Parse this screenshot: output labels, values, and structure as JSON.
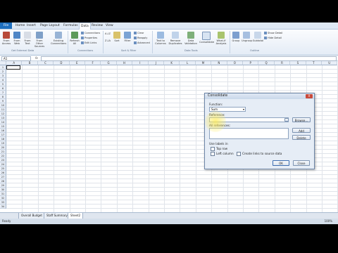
{
  "tabs": [
    "File",
    "Home",
    "Insert",
    "Page Layout",
    "Formulas",
    "Data",
    "Review",
    "View"
  ],
  "ribbon": {
    "buttons": [
      "From Access",
      "From Web",
      "From Text",
      "From Other Sources",
      "Existing Connections",
      "Refresh All",
      "Sort",
      "Filter",
      "Text to Columns",
      "Remove Duplicates",
      "Data Validation",
      "Consolidate",
      "What-If Analysis",
      "Group",
      "Ungroup",
      "Subtotal"
    ],
    "small_items": [
      "Connections",
      "Properties",
      "Edit Links",
      "Clear",
      "Reapply",
      "Advanced",
      "Show Detail",
      "Hide Detail"
    ],
    "sort_az": "A↓Z",
    "sort_za": "Z↓A",
    "groups": [
      "Get External Data",
      "Connections",
      "Sort & Filter",
      "Data Tools",
      "Outline"
    ]
  },
  "formula_bar": {
    "name_box": "A1",
    "fx": "fx",
    "formula": ""
  },
  "columns": [
    "A",
    "B",
    "C",
    "D",
    "E",
    "F",
    "G",
    "H",
    "I",
    "J",
    "K",
    "L",
    "M",
    "N",
    "O",
    "P",
    "Q",
    "R",
    "S",
    "T",
    "U"
  ],
  "rows": [
    "1",
    "2",
    "3",
    "4",
    "5",
    "6",
    "7",
    "8",
    "9",
    "10",
    "11",
    "12",
    "13",
    "14",
    "15",
    "16",
    "17",
    "18",
    "19",
    "20",
    "21",
    "22",
    "23",
    "24",
    "25",
    "26",
    "27",
    "28",
    "29",
    "30",
    "31",
    "32",
    "33",
    "34",
    "35"
  ],
  "sheets": [
    "Overall Budget",
    "Staff Summary",
    "Sheet2"
  ],
  "status": "Ready",
  "zoom": "100%",
  "dialog": {
    "title": "Consolidate",
    "close": "X",
    "function_label": "Function:",
    "function_value": "Sum",
    "reference_label": "Reference:",
    "reference_value": "",
    "browse_label": "Browse...",
    "all_refs_label": "All references:",
    "add_label": "Add",
    "delete_label": "Delete",
    "use_labels_label": "Use labels in",
    "top_row_label": "Top row",
    "left_column_label": "Left column",
    "create_links_label": "Create links to source data",
    "ok_label": "OK",
    "close_label": "Close"
  }
}
